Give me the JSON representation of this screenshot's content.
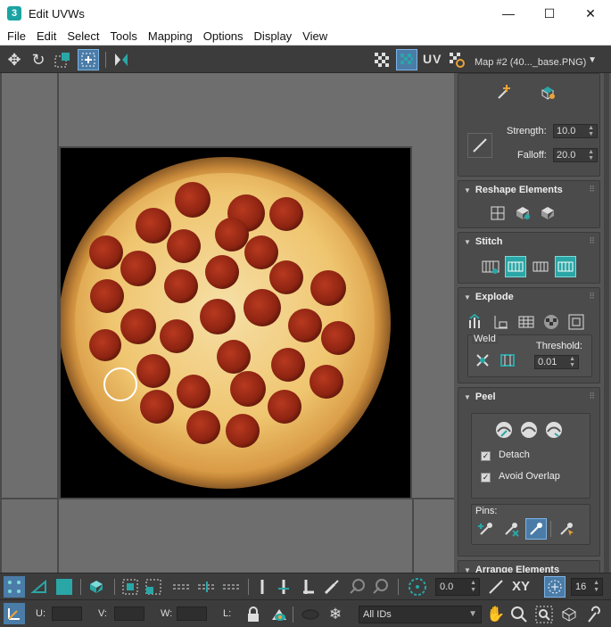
{
  "window": {
    "title": "Edit UVWs",
    "app_icon": "3",
    "minimize": "—",
    "maximize": "☐",
    "close": "✕"
  },
  "menu": [
    "File",
    "Edit",
    "Select",
    "Tools",
    "Mapping",
    "Options",
    "Display",
    "View"
  ],
  "toolbar": {
    "uv_label": "UV",
    "map_select": "Map #2 (40..._base.PNG)"
  },
  "panel": {
    "brush": {
      "strength_label": "Strength:",
      "strength": "10.0",
      "falloff_label": "Falloff:",
      "falloff": "20.0"
    },
    "reshape": {
      "title": "Reshape Elements"
    },
    "stitch": {
      "title": "Stitch"
    },
    "explode": {
      "title": "Explode",
      "weld_label": "Weld",
      "threshold_label": "Threshold:",
      "threshold": "0.01"
    },
    "peel": {
      "title": "Peel",
      "detach_label": "Detach",
      "detach_checked": true,
      "avoid_overlap_label": "Avoid Overlap",
      "avoid_overlap_checked": true,
      "pins_label": "Pins:"
    },
    "arrange": {
      "title": "Arrange Elements"
    }
  },
  "bottom": {
    "rotation_value": "0.0",
    "xy_label": "XY",
    "grid_count": "16",
    "u_label": "U:",
    "v_label": "V:",
    "w_label": "W:",
    "l_label": "L:",
    "ids_select": "All IDs"
  },
  "colors": {
    "accent": "#2aa6a6",
    "active": "#4b7ca8",
    "bg": "#444444"
  }
}
